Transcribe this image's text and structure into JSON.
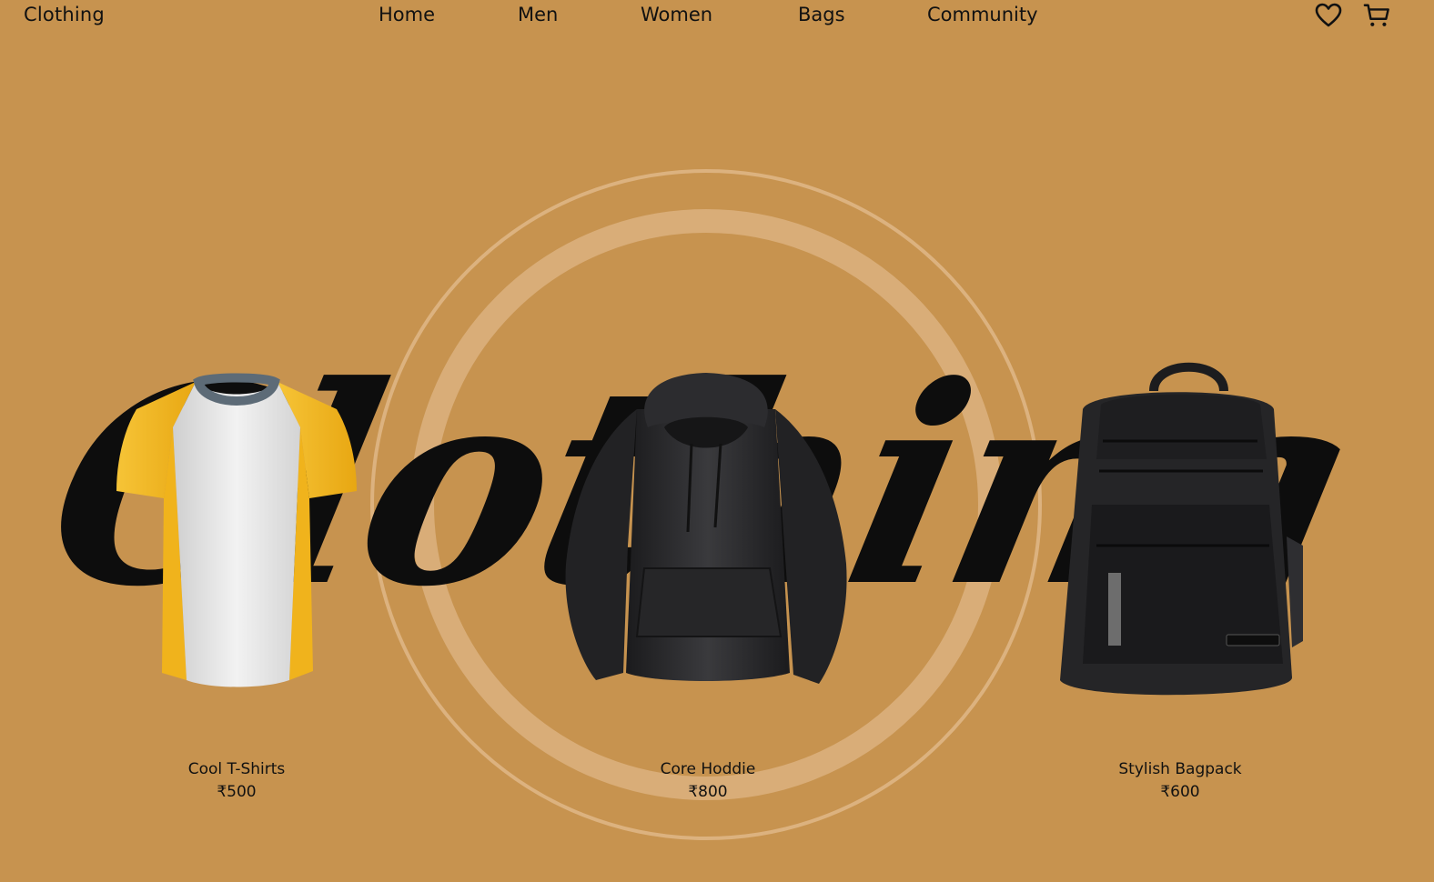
{
  "header": {
    "logo": "Clothing",
    "nav": [
      {
        "label": "Home"
      },
      {
        "label": "Men"
      },
      {
        "label": "Women"
      },
      {
        "label": "Bags"
      },
      {
        "label": "Community"
      }
    ],
    "icons": [
      "heart-icon",
      "cart-icon"
    ]
  },
  "hero": {
    "script_text": "Clothing"
  },
  "products": [
    {
      "name": "Cool T-Shirts",
      "price": "₹500",
      "image": "t-shirt"
    },
    {
      "name": "Core Hoddie",
      "price": "₹800",
      "image": "hoodie"
    },
    {
      "name": "Stylish Bagpack",
      "price": "₹600",
      "image": "backpack"
    }
  ],
  "colors": {
    "background": "#c7934f",
    "ring": "#dcb27f",
    "text": "#111111",
    "tshirt_accent": "#f2b51e",
    "tshirt_body": "#e6e6e6",
    "collar": "#5d6b77"
  }
}
